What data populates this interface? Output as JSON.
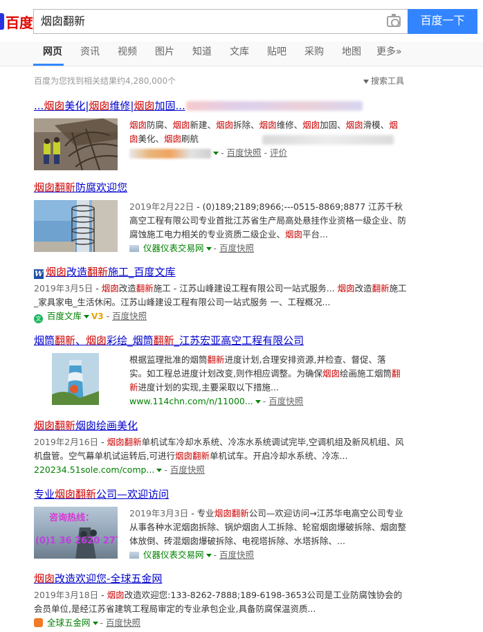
{
  "header": {
    "logo_text": "百度",
    "query": "烟囱翻新",
    "search_button": "百度一下"
  },
  "nav": {
    "items": [
      "网页",
      "资讯",
      "视频",
      "图片",
      "知道",
      "文库",
      "贴吧",
      "采购",
      "地图",
      "更多»"
    ],
    "active_index": 0
  },
  "meta": {
    "result_count": "百度为您找到相关结果约4,280,000个",
    "search_tools": "搜索工具"
  },
  "results": [
    {
      "title_html": "...<em>烟囱</em>美化|<em>烟囱</em>维修|<em>烟囱</em>加固...",
      "desc_html": "<em>烟囱</em>防腐、<em>烟囱</em>新建、<em>烟囱</em>拆除、<em>烟囱</em>维修、<em>烟囱</em>加固、<em>烟囱</em>滑模、<em>烟囱</em>美化、<em>烟囱</em>刷航",
      "kuaizhao": "百度快照",
      "pingjia": "评价"
    },
    {
      "title_html": "<em>烟囱翻新</em>防腐欢迎您",
      "date": "2019年2月22日",
      "desc_html": "- (0)189;2189;8966;---0515-8869;8877 江苏千秋高空工程有限公司专业首批江苏省生产局高处悬挂作业资格一级企业、防腐蚀施工电力相关的专业资质二级企业、<em>烟囱</em>平台...",
      "source": "仪器仪表交易网",
      "kuaizhao": "百度快照"
    },
    {
      "title_html": "<em>烟囱</em>改造<em>翻新</em>施工_百度文库",
      "date": "2019年3月5日",
      "desc_html": "- <em>烟囱</em>改造<em>翻新</em>施工 - 江苏山峰建设工程有限公司一站式服务... <em>烟囱</em>改造<em>翻新</em>施工_家具家电_生活休闲。江苏山峰建设工程有限公司一站式服务 一、工程概况...",
      "source": "百度文库",
      "v_badge": "V3",
      "kuaizhao": "百度快照"
    },
    {
      "title_html": "烟筒<em>翻新</em>、<em>烟囱</em>彩绘_烟筒<em>翻新</em>_江苏宏亚高空工程有限公司",
      "desc_html": "根据监理批准的烟筒<em>翻新</em>进度计划,合理安排资源,并检查、督促、落实。如工程总进度计划改变,则作相应调整。为确保<em>烟囱</em>绘画施工烟筒<em>翻新</em>进度计划的实现,主要采取以下措施...",
      "source": "www.114chn.com/n/11000...",
      "kuaizhao": "百度快照"
    },
    {
      "title_html": "<em>烟囱翻新</em>烟囱绘画美化",
      "date": "2019年2月16日",
      "desc_html": "- <em>烟囱翻新</em>单机试车冷却水系统、冷冻水系统调试完毕,空调机组及新风机组、风机盘管。空气幕单机试运转后,可进行<em>烟囱翻新</em>单机试车。开启冷却水系统、冷冻...",
      "source": "220234.51sole.com/comp...",
      "kuaizhao": "百度快照"
    },
    {
      "title_html": "专业<em>烟囱翻新</em>公司—欢迎访问",
      "date": "2019年3月3日",
      "desc_html": "- 专业<em>烟囱翻新</em>公司—欢迎访问→江苏华电高空公司专业从事各种水泥烟囱拆除、锅炉烟囱人工拆除、轮窑烟囱爆破拆除、烟囱整体放倒、砖混烟囱爆破拆除、电视塔拆除、水塔拆除、...",
      "thumb_text_1": "咨询热线：",
      "thumb_text_2": "(0)1 36 2620 277",
      "source": "仪器仪表交易网",
      "kuaizhao": "百度快照"
    },
    {
      "title_html": "<em>烟囱</em>改造欢迎您-全球五金网",
      "date": "2019年3月18日",
      "desc_html": "- <em>烟囱</em>改造欢迎您:133-8262-7888;189-6198-3653公司是工业防腐蚀协会的会员单位,是经江苏省建筑工程局审定的专业承包企业,具备防腐保温资质...",
      "source": "全球五金网",
      "kuaizhao": "百度快照"
    }
  ]
}
